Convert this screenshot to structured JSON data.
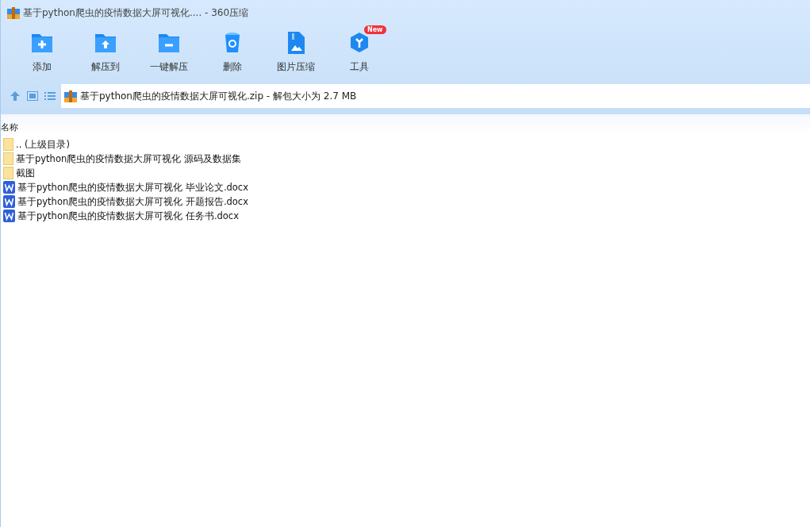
{
  "window": {
    "title": "基于python爬虫的疫情数据大屏可视化.... - 360压缩"
  },
  "toolbar": [
    {
      "kind": "add",
      "label": "添加"
    },
    {
      "kind": "extract-to",
      "label": "解压到"
    },
    {
      "kind": "one-click",
      "label": "一键解压"
    },
    {
      "kind": "delete",
      "label": "删除"
    },
    {
      "kind": "image",
      "label": "图片压缩"
    },
    {
      "kind": "tools",
      "label": "工具",
      "badge": "New"
    }
  ],
  "address": {
    "path": "基于python爬虫的疫情数据大屏可视化.zip - 解包大小为 2.7 MB"
  },
  "table": {
    "columns": [
      "名称"
    ],
    "rows": [
      {
        "kind": "folder",
        "name": ".. (上级目录)"
      },
      {
        "kind": "folder",
        "name": "基于python爬虫的疫情数据大屏可视化 源码及数据集"
      },
      {
        "kind": "folder",
        "name": "截图"
      },
      {
        "kind": "docx",
        "name": "基于python爬虫的疫情数据大屏可视化 毕业论文.docx"
      },
      {
        "kind": "docx",
        "name": "基于python爬虫的疫情数据大屏可视化 开题报告.docx"
      },
      {
        "kind": "docx",
        "name": "基于python爬虫的疫情数据大屏可视化 任务书.docx"
      }
    ]
  }
}
